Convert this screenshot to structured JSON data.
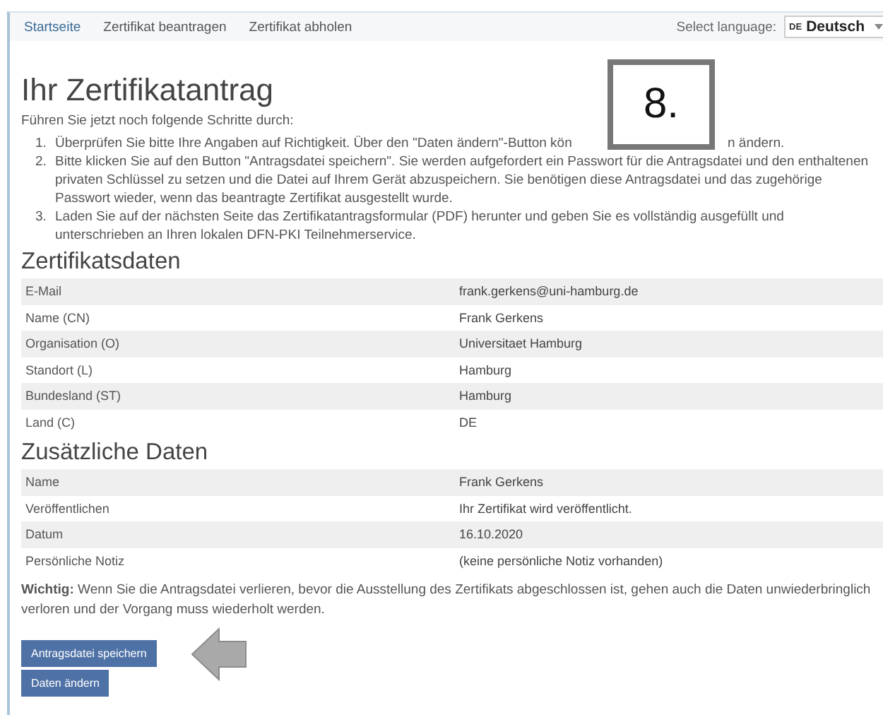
{
  "nav": {
    "items": [
      {
        "label": "Startseite",
        "selected": true
      },
      {
        "label": "Zertifikat beantragen",
        "selected": false
      },
      {
        "label": "Zertifikat abholen",
        "selected": false
      }
    ],
    "language": {
      "label": "Select language:",
      "flag": "DE",
      "value": "Deutsch"
    }
  },
  "title": "Ihr Zertifikatantrag",
  "intro": "Führen Sie jetzt noch folgende Schritte durch:",
  "steps": [
    {
      "number": "1.",
      "text": "Überprüfen Sie bitte Ihre Angaben auf Richtigkeit. Über den \"Daten ändern\"-Button kön",
      "text_after": "n ändern."
    },
    {
      "number": "2.",
      "text": "Bitte klicken Sie auf den Button \"Antragsdatei speichern\". Sie werden aufgefordert ein Passwort für die Antragsdatei und den enthaltenen privaten Schlüssel zu setzen und die Datei auf Ihrem Gerät abzuspeichern. Sie benötigen diese Antragsdatei und das zugehörige Passwort wieder, wenn das beantragte Zertifikat ausgestellt wurde."
    },
    {
      "number": "3.",
      "text": "Laden Sie auf der nächsten Seite das Zertifikatantragsformular (PDF) herunter und geben Sie es vollständig ausgefüllt und unterschrieben an Ihren lokalen DFN-PKI Teilnehmerservice."
    }
  ],
  "sections": [
    {
      "title": "Zertifikatsdaten",
      "rows": [
        {
          "label": "E-Mail",
          "value": "frank.gerkens@uni-hamburg.de"
        },
        {
          "label": "Name (CN)",
          "value": "Frank Gerkens"
        },
        {
          "label": "Organisation (O)",
          "value": "Universitaet Hamburg"
        },
        {
          "label": "Standort (L)",
          "value": "Hamburg"
        },
        {
          "label": "Bundesland (ST)",
          "value": "Hamburg"
        },
        {
          "label": "Land (C)",
          "value": "DE"
        }
      ]
    },
    {
      "title": "Zusätzliche Daten",
      "rows": [
        {
          "label": "Name",
          "value": "Frank Gerkens"
        },
        {
          "label": "Veröffentlichen",
          "value": "Ihr Zertifikat wird veröffentlicht."
        },
        {
          "label": "Datum",
          "value": "16.10.2020"
        },
        {
          "label": "Persönliche Notiz",
          "value": "(keine persönliche Notiz vorhanden)"
        }
      ]
    }
  ],
  "warning": "**Wichtig:** Wenn Sie die Antragsdatei verlieren, bevor die Ausstellung des Zertifikats abgeschlossen ist, gehen auch die Daten unwiederbringlich verloren und der Vorgang muss wiederholt werden.",
  "buttons": [
    "Antragsdatei speichern",
    "Daten ändern"
  ],
  "step_marker": "8."
}
